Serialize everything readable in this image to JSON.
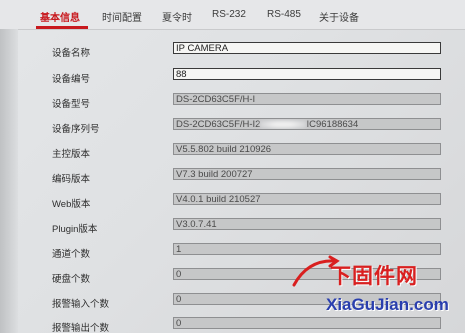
{
  "tabs": [
    {
      "label": "基本信息",
      "active": true
    },
    {
      "label": "时间配置",
      "active": false
    },
    {
      "label": "夏令时",
      "active": false
    },
    {
      "label": "RS-232",
      "active": false
    },
    {
      "label": "RS-485",
      "active": false
    },
    {
      "label": "关于设备",
      "active": false
    }
  ],
  "fields": {
    "device_name": {
      "label": "设备名称",
      "value": "IP CAMERA"
    },
    "device_number": {
      "label": "设备编号",
      "value": "88"
    },
    "device_model": {
      "label": "设备型号",
      "value": "DS-2CD63C5F/H-I"
    },
    "serial_number": {
      "label": "设备序列号",
      "value_prefix": "DS-2CD63C5F/H-I2",
      "value_suffix": "IC96188634"
    },
    "main_version": {
      "label": "主控版本",
      "value": "V5.5.802 build 210926"
    },
    "encode_version": {
      "label": "编码版本",
      "value": "V7.3 build 200727"
    },
    "web_version": {
      "label": "Web版本",
      "value": "V4.0.1 build 210527"
    },
    "plugin_version": {
      "label": "Plugin版本",
      "value": "V3.0.7.41"
    },
    "channel_count": {
      "label": "通道个数",
      "value": "1"
    },
    "disk_count": {
      "label": "硬盘个数",
      "value": "0"
    },
    "alarm_in_count": {
      "label": "报警输入个数",
      "value": "0"
    },
    "alarm_out_count": {
      "label": "报警输出个数",
      "value": "0"
    }
  },
  "watermark": {
    "top": "下固件网",
    "bottom": "XiaGuJian.com"
  },
  "colors": {
    "accent": "#c8191e",
    "watermark_red": "#d91f1f",
    "watermark_blue": "#2a3fae"
  }
}
